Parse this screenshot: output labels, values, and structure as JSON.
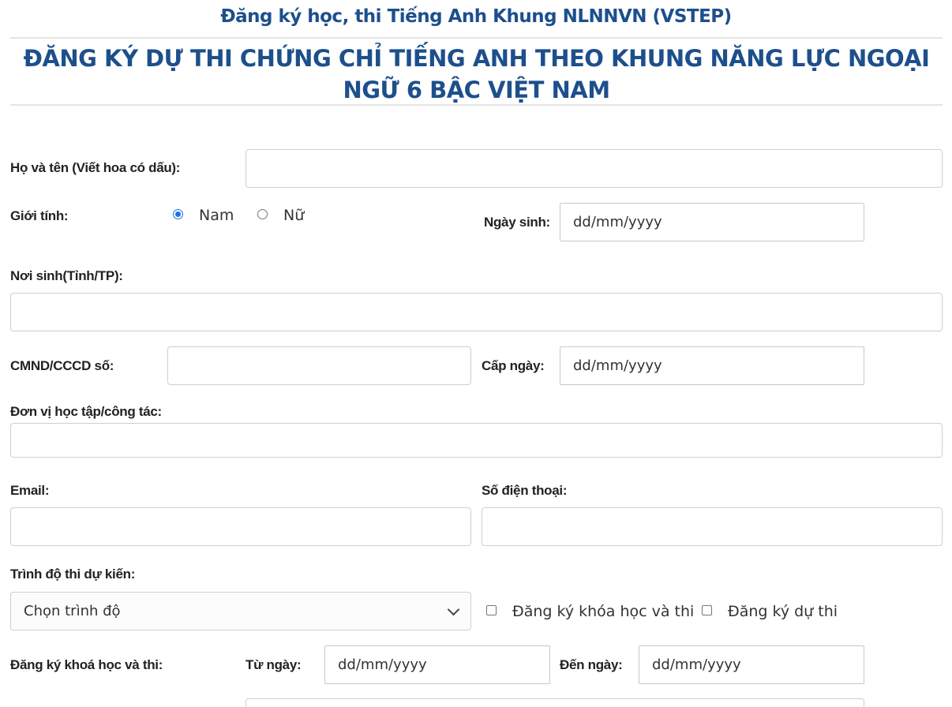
{
  "header": {
    "site_title": "Đăng ký học, thi Tiếng Anh Khung NLNNVN (VSTEP)",
    "page_title": "ĐĂNG KÝ DỰ THI CHỨNG CHỈ TIẾNG ANH THEO KHUNG NĂNG LỰC NGOẠI NGỮ 6 BẬC VIỆT NAM"
  },
  "form": {
    "full_name_label": "Họ và tên (Viết hoa có dấu):",
    "full_name_value": "",
    "gender_label": "Giới tính:",
    "gender_options": [
      "Nam",
      "Nữ"
    ],
    "gender_selected": "Nam",
    "birth_date_label": "Ngày sinh:",
    "birth_date_value": "dd/mm/yyyy",
    "birth_place_label": "Nơi sinh(Tỉnh/TP):",
    "birth_place_value": "",
    "id_number_label": "CMND/CCCD số:",
    "id_number_value": "",
    "issue_date_label": "Cấp ngày:",
    "issue_date_value": "dd/mm/yyyy",
    "workplace_label": "Đơn vị học tập/công tác:",
    "workplace_value": "",
    "email_label": "Email:",
    "email_value": "",
    "phone_label": "Số điện thoại:",
    "phone_value": "",
    "level_label": "Trình độ thi dự kiến:",
    "level_select_value": "Chọn trình độ",
    "checkbox_course_exam": "Đăng ký khóa học và thi",
    "checkbox_exam_only": "Đăng ký dự thi",
    "course_exam_label": "Đăng ký khoá học và thi:",
    "from_date_label": "Từ ngày:",
    "from_date_value": "dd/mm/yyyy",
    "to_date_label": "Đến ngày:",
    "to_date_value": "dd/mm/yyyy"
  },
  "colors": {
    "title_blue": "#1d4f8c",
    "radio_blue": "#1a73e8"
  }
}
